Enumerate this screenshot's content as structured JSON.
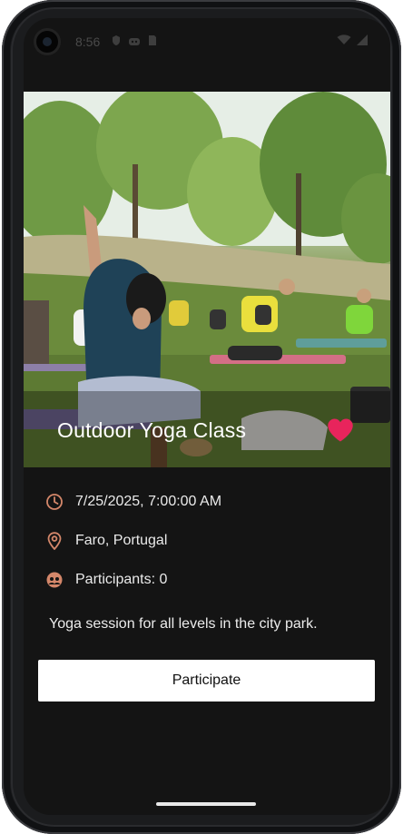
{
  "status_bar": {
    "time": "8:56",
    "icons_left": [
      "shield-icon",
      "android-icon",
      "sim-card-icon"
    ],
    "icons_right": [
      "wifi-icon",
      "cell-signal-icon"
    ]
  },
  "event": {
    "title": "Outdoor Yoga Class",
    "favorited": true,
    "datetime": "7/25/2025, 7:00:00 AM",
    "location": "Faro, Portugal",
    "participants": "Participants: 0",
    "description": "Yoga session for all levels in the city park.",
    "participate_label": "Participate"
  },
  "colors": {
    "background": "#141414",
    "icon_accent": "#d4876a",
    "heart": "#e8245c",
    "button_bg": "#ffffff"
  }
}
